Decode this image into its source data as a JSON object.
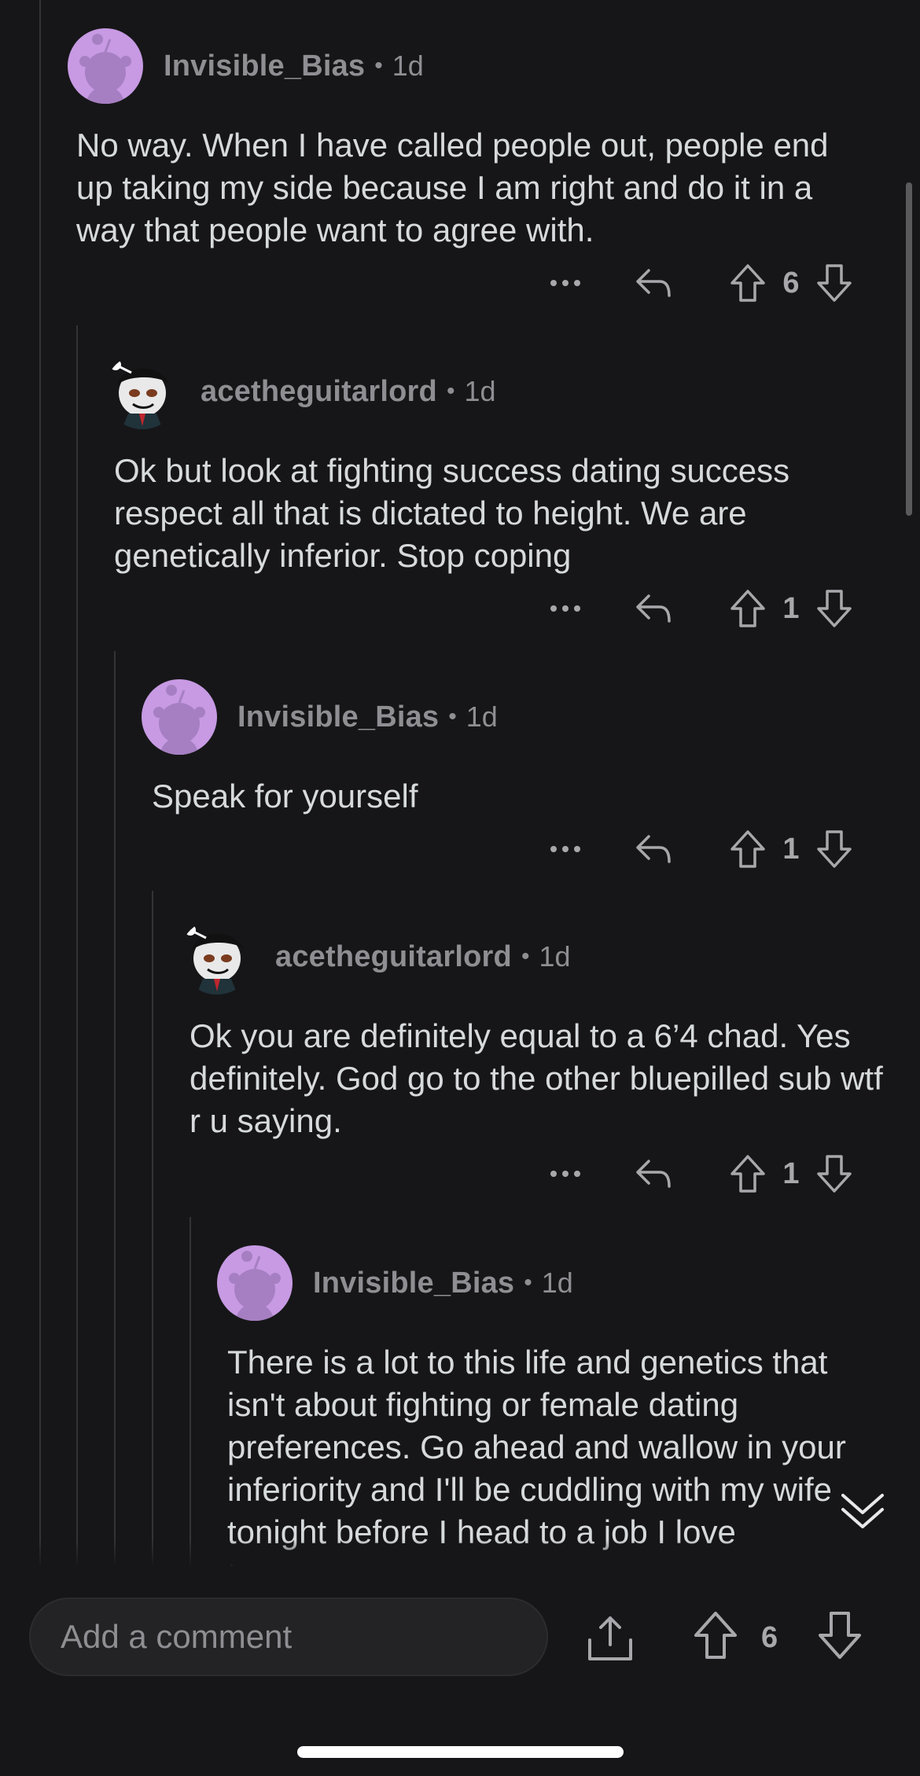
{
  "comments": [
    {
      "username": "Invisible_Bias",
      "separator": "•",
      "age": "1d",
      "avatar": "snoo-purple-avatar",
      "body": "No way. When I have called people out, people end up taking my side because I am right and do it in a way that people want to agree with.",
      "votes": "6"
    },
    {
      "username": "acetheguitarlord",
      "separator": "•",
      "age": "1d",
      "avatar": "snoo-suit-avatar",
      "body": "Ok but look at fighting success dating success respect all that is dictated to height. We are genetically inferior. Stop coping",
      "votes": "1"
    },
    {
      "username": "Invisible_Bias",
      "separator": "•",
      "age": "1d",
      "avatar": "snoo-purple-avatar",
      "body": "Speak for yourself",
      "votes": "1"
    },
    {
      "username": "acetheguitarlord",
      "separator": "•",
      "age": "1d",
      "avatar": "snoo-suit-avatar",
      "body": "Ok you are definitely equal to a 6’4 chad. Yes definitely. God go to the other bluepilled sub wtf r u saying.",
      "votes": "1"
    },
    {
      "username": "Invisible_Bias",
      "separator": "•",
      "age": "1d",
      "avatar": "snoo-purple-avatar",
      "body": "There is a lot to this life and genetics that isn't about fighting or female dating preferences. Go ahead and wallow in your inferiority and I'll be cuddling with my wife tonight before I head to a job I love tomorrow."
    }
  ],
  "bottom_bar": {
    "comment_placeholder": "Add a comment",
    "post_votes": "6"
  },
  "icons": {
    "more": "more-options-icon",
    "reply": "reply-icon",
    "upvote": "upvote-arrow-icon",
    "downvote": "downvote-arrow-icon",
    "share": "share-icon",
    "collapse": "double-chevron-down-icon"
  },
  "colors": {
    "background": "#161618",
    "text": "#d7dadc",
    "meta": "#8e8e93",
    "avatar_purple": "#c79ae3"
  }
}
